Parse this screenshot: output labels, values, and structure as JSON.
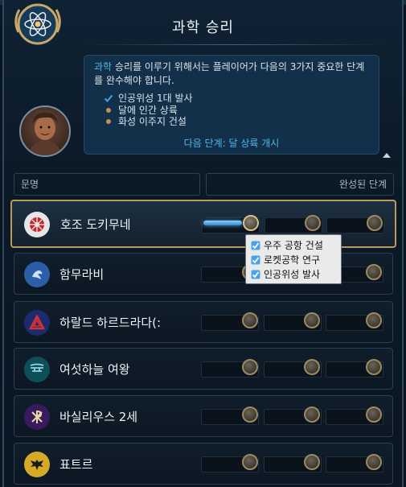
{
  "panel": {
    "title": "과학 승리",
    "description_highlight": "과학",
    "description_rest": " 승리를 이루기 위해서는 플레이어가 다음의 3가지 중요한 단계를 완수해야 합니다.",
    "steps": [
      {
        "label": "인공위성 1대 발사",
        "status": "complete"
      },
      {
        "label": "달에 인간 상륙",
        "status": "pending"
      },
      {
        "label": "화성 이주지 건설",
        "status": "pending"
      }
    ],
    "next_step": "다음 단계: 달 상륙 개시"
  },
  "table": {
    "col_civ": "문명",
    "col_completed": "완성된 단계",
    "rows": [
      {
        "name": "호조 도키무네",
        "icon": "red-crest-icon",
        "progress": 1
      },
      {
        "name": "함무라비",
        "icon": "blue-crest-icon",
        "progress": 0
      },
      {
        "name": "하랄드 하르드라다(:",
        "icon": "red-triangle-crest-icon",
        "progress": 0
      },
      {
        "name": "여섯하늘 여왕",
        "icon": "teal-glyph-icon",
        "progress": 0
      },
      {
        "name": "바실리우스 2세",
        "icon": "purple-chi-rho-icon",
        "progress": 0
      },
      {
        "name": "표트르",
        "icon": "gold-eagle-icon",
        "progress": 0
      }
    ]
  },
  "tooltip": {
    "items": [
      "우주 공항 건설",
      "로켓공학 연구",
      "인공위성 발사"
    ]
  },
  "colors": {
    "accent_blue": "#4fb5e8",
    "gold": "#b89a5a",
    "check": "#4aa3e6"
  }
}
